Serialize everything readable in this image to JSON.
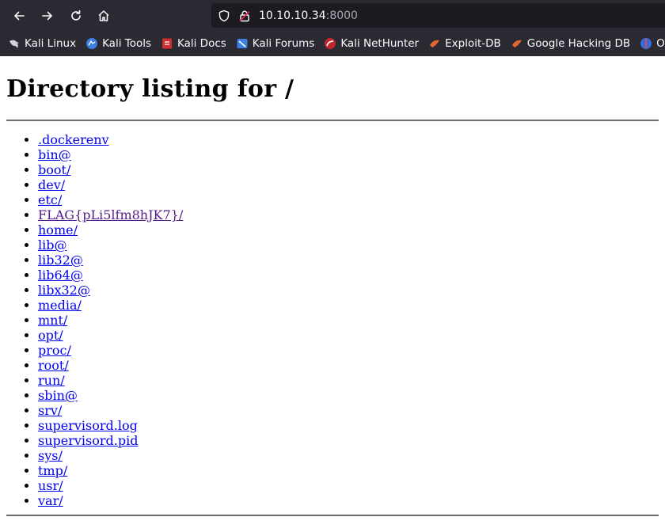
{
  "browser": {
    "url_host": "10.10.10.34",
    "url_port": ":8000",
    "bookmarks": [
      {
        "label": "Kali Linux",
        "icon": "kali-dragon-icon"
      },
      {
        "label": "Kali Tools",
        "icon": "kali-tools-icon"
      },
      {
        "label": "Kali Docs",
        "icon": "kali-docs-icon"
      },
      {
        "label": "Kali Forums",
        "icon": "kali-forums-icon"
      },
      {
        "label": "Kali NetHunter",
        "icon": "kali-nethunter-icon"
      },
      {
        "label": "Exploit-DB",
        "icon": "exploit-db-icon"
      },
      {
        "label": "Google Hacking DB",
        "icon": "ghdb-icon"
      },
      {
        "label": "OffS",
        "icon": "offsec-icon"
      }
    ]
  },
  "page": {
    "title": "Directory listing for /",
    "entries": [
      ".dockerenv",
      "bin@",
      "boot/",
      "dev/",
      "etc/",
      "FLAG{pLi5lfm8hJK7}/",
      "home/",
      "lib@",
      "lib32@",
      "lib64@",
      "libx32@",
      "media/",
      "mnt/",
      "opt/",
      "proc/",
      "root/",
      "run/",
      "sbin@",
      "srv/",
      "supervisord.log",
      "supervisord.pid",
      "sys/",
      "tmp/",
      "usr/",
      "var/"
    ],
    "visited_entry": "FLAG{pLi5lfm8hJK7}/"
  },
  "colors": {
    "chrome_bg": "#2b2a33",
    "urlbar_bg": "#1c1b22",
    "link": "#0000ee",
    "link_visited": "#551a8b"
  }
}
